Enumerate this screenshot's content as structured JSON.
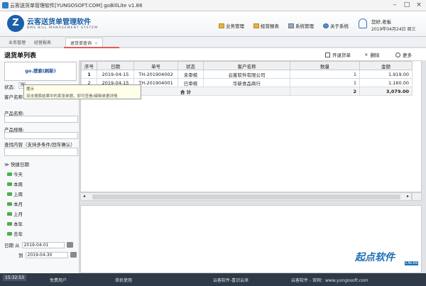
{
  "window": {
    "title": "云客送货单管理软件[YUNGOSOFT.COM]  goBillLite v1.88"
  },
  "brand": {
    "name": "云客送货单管理软件",
    "sub": "BMS BILL MANAGEMENT SYSTEM"
  },
  "menu": {
    "items": [
      {
        "label": "业务管理",
        "icon": "folder-icon"
      },
      {
        "label": "经营报表",
        "icon": "folder-icon"
      },
      {
        "label": "系统管理",
        "icon": "settings-icon"
      },
      {
        "label": "关于系统",
        "icon": "info-icon"
      }
    ]
  },
  "user": {
    "greeting": "您好,老板",
    "date": "2019年04月24日 周三"
  },
  "tabs": [
    {
      "label": "业务管理"
    },
    {
      "label": "经营报表"
    },
    {
      "label": "退货单查询",
      "close": "×"
    }
  ],
  "page": {
    "title": "退货单列表"
  },
  "toolbar": {
    "open_label": "开退货单",
    "delete_label": "删除",
    "more_label": "更多"
  },
  "search": {
    "button_label": "go.搜索(刷新)",
    "status_label": "状态:",
    "status_value": "所",
    "customer_label": "客户名称",
    "product_name_label": "产品名称:",
    "product_spec_label": "产品规格:",
    "query_label": "查找内容（支持多条件/回车确认）"
  },
  "tooltip": {
    "title": "提示",
    "text": "双击搜索结果中的某张单据，即可查看/编辑单据详情"
  },
  "quick": {
    "header": "快捷日期",
    "items": [
      "今天",
      "本周",
      "上周",
      "本月",
      "上月",
      "本年",
      "去年"
    ]
  },
  "date": {
    "from_label": "日期 从",
    "from_value": "2019-04-01",
    "to_label": "到",
    "to_value": "2019-04-30"
  },
  "grid": {
    "columns": [
      "序号",
      "日期",
      "单号",
      "状态",
      "客户名称",
      "数量",
      "金额"
    ],
    "rows": [
      {
        "no": "1",
        "date": "2019-04-15",
        "bill": "TH-201904002",
        "status": "未审核",
        "customer": "云客软件有限公司",
        "qty": "1",
        "amount": "1,919.00"
      },
      {
        "no": "2",
        "date": "2019-04-15",
        "bill": "TH-201904001",
        "status": "已审核",
        "customer": "华新食品商行",
        "qty": "1",
        "amount": "1,160.00"
      }
    ],
    "total": {
      "label": "合 计",
      "qty": "2",
      "amount": "3,079.00"
    }
  },
  "statusbar": {
    "time": "15:32:53",
    "items": [
      "免费用户",
      "单机使用",
      "云客软件-喜识云来",
      "云客软件 - 官网：www.yungosoft.com"
    ]
  },
  "watermark": {
    "text": "起点软件",
    "sub": "CNCRK"
  },
  "colors": {
    "brand": "#1b5fa8",
    "statusbar": "#2f3a48",
    "accent": "#e05c5c"
  }
}
